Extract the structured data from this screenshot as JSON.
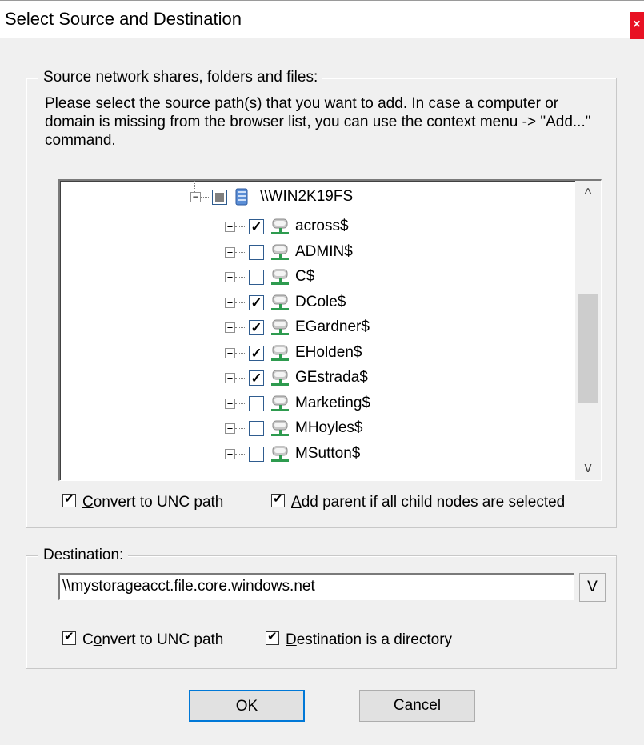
{
  "window": {
    "title": "Select Source and Destination",
    "close_label": "×"
  },
  "source_group": {
    "legend": "Source network shares, folders and files:",
    "instructions": "Please select the source path(s) that you want to add. In case a computer or domain is missing from the browser list, you can use the context menu -> \"Add...\" command."
  },
  "tree": {
    "server": {
      "label": "\\\\WIN2K19FS",
      "state": "partial",
      "icon": "server-icon"
    },
    "shares": [
      {
        "label": "across$",
        "checked": true
      },
      {
        "label": "ADMIN$",
        "checked": false
      },
      {
        "label": "C$",
        "checked": false
      },
      {
        "label": "DCole$",
        "checked": true
      },
      {
        "label": "EGardner$",
        "checked": true
      },
      {
        "label": "EHolden$",
        "checked": true
      },
      {
        "label": "GEstrada$",
        "checked": true
      },
      {
        "label": "Marketing$",
        "checked": false
      },
      {
        "label": "MHoyles$",
        "checked": false
      },
      {
        "label": "MSutton$",
        "checked": false
      }
    ],
    "scroll_up": "^",
    "scroll_down": "v"
  },
  "source_options": {
    "convert_unc": {
      "label": "onvert to UNC path",
      "accel": "C",
      "checked": true
    },
    "add_parent": {
      "label": "dd parent if all child nodes are selected",
      "accel": "A",
      "checked": true
    }
  },
  "destination_group": {
    "legend": "Destination:",
    "value": "\\\\mystorageacct.file.core.windows.net",
    "dropdown_label": "V"
  },
  "destination_options": {
    "convert_unc": {
      "pre": "C",
      "accel": "o",
      "post": "nvert to UNC path",
      "checked": true
    },
    "is_directory": {
      "accel": "D",
      "post": "estination is a directory",
      "checked": true
    }
  },
  "buttons": {
    "ok": "OK",
    "cancel": "Cancel"
  },
  "colors": {
    "accent": "#0078d7",
    "close": "#e81123",
    "share_icon": "#2e9b4f"
  }
}
